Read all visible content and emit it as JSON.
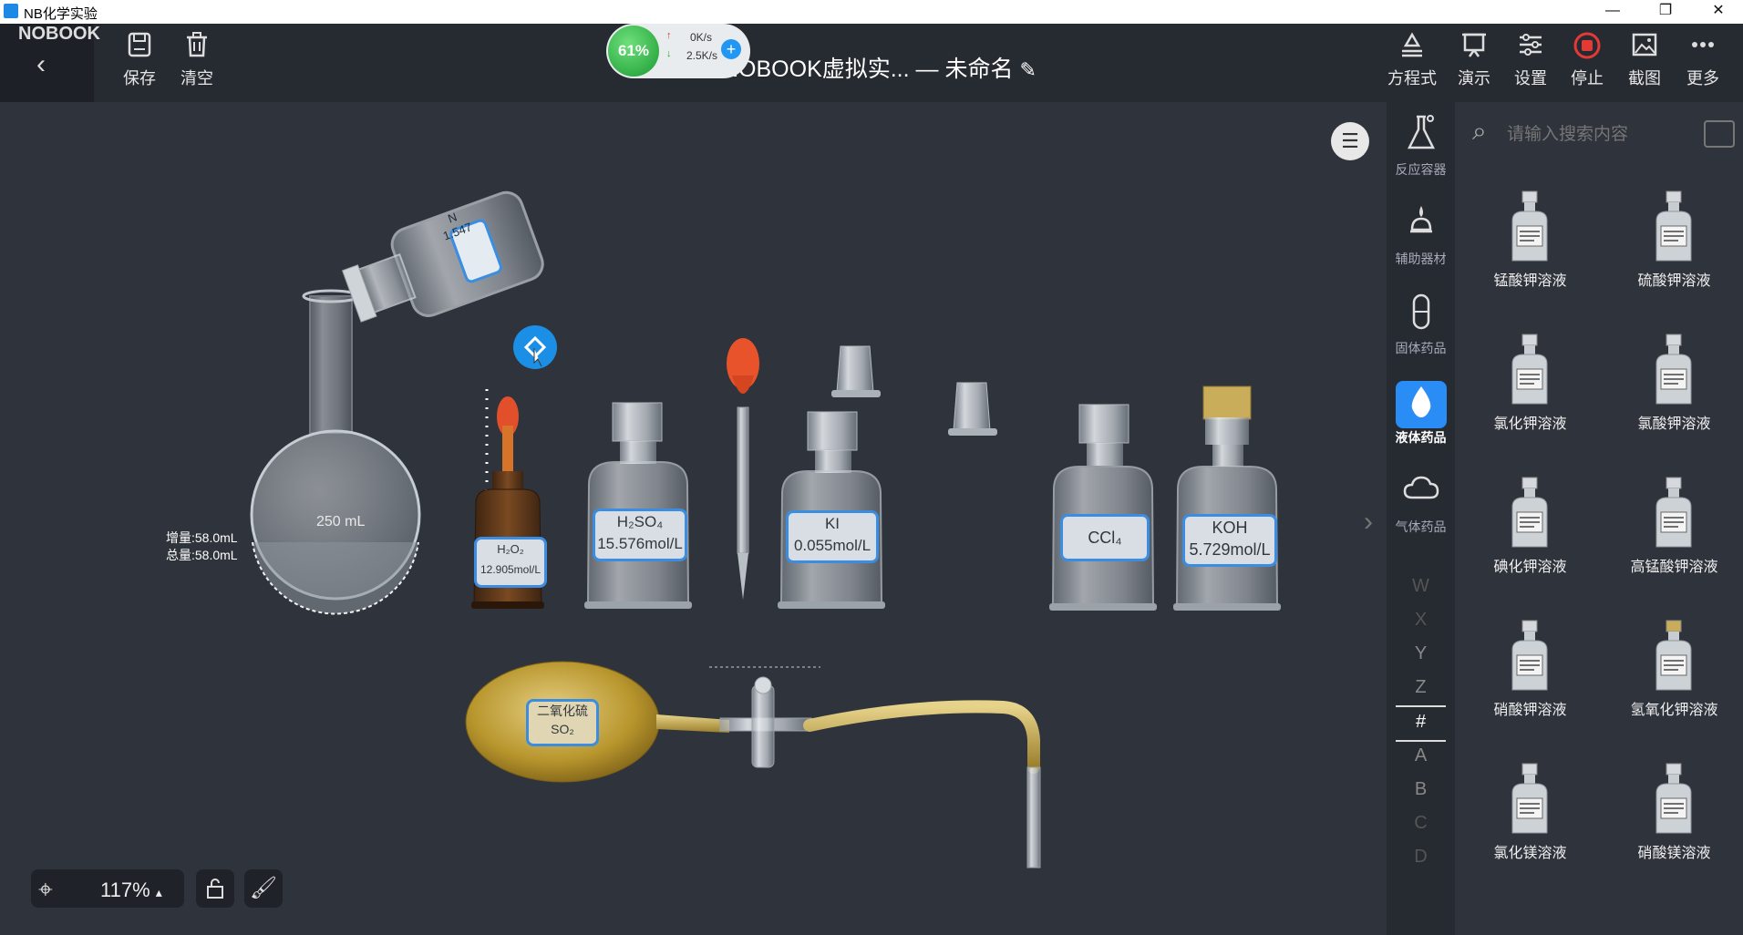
{
  "window": {
    "title": "NB化学实验",
    "minimize": "—",
    "maximize": "❐",
    "close": "✕"
  },
  "logo": "NOBOOK",
  "toolbar": {
    "back": "‹",
    "save_label": "保存",
    "clear_label": "清空",
    "doc_title": "NOBOOK虚拟实... — 未命名",
    "right": [
      {
        "label": "方程式",
        "icon": "equation-icon"
      },
      {
        "label": "演示",
        "icon": "present-icon"
      },
      {
        "label": "设置",
        "icon": "settings-icon"
      },
      {
        "label": "停止",
        "icon": "stop-icon"
      },
      {
        "label": "截图",
        "icon": "screenshot-icon"
      },
      {
        "label": "更多",
        "icon": "more-icon"
      }
    ]
  },
  "gauge": {
    "percent": "61%",
    "up": "0K/s",
    "down": "2.5K/s"
  },
  "sidebar": {
    "categories": [
      {
        "label": "反应容器",
        "icon": "flask-icon"
      },
      {
        "label": "辅助器材",
        "icon": "lamp-icon"
      },
      {
        "label": "固体药品",
        "icon": "capsule-icon"
      },
      {
        "label": "液体药品",
        "icon": "drop-icon"
      },
      {
        "label": "气体药品",
        "icon": "cloud-icon"
      }
    ],
    "letters": [
      "W",
      "X",
      "Y",
      "Z",
      "#",
      "A",
      "B",
      "C",
      "D"
    ]
  },
  "search": {
    "placeholder": "请输入搜索内容"
  },
  "reagents": [
    {
      "name": "锰酸钾溶液"
    },
    {
      "name": "硫酸钾溶液"
    },
    {
      "name": "氯化钾溶液"
    },
    {
      "name": "氯酸钾溶液"
    },
    {
      "name": "碘化钾溶液"
    },
    {
      "name": "高锰酸钾溶液"
    },
    {
      "name": "硝酸钾溶液"
    },
    {
      "name": "氢氧化钾溶液"
    },
    {
      "name": "氯化镁溶液"
    },
    {
      "name": "硝酸镁溶液"
    }
  ],
  "canvas": {
    "flask_volume": "250 mL",
    "increment": "增量:58.0mL",
    "total": "总量:58.0mL",
    "tilted_label": "N",
    "tilted_value": "1.547",
    "h2o2_formula": "H₂O₂",
    "h2o2_conc": "12.905mol/L",
    "h2so4_formula": "H₂SO₄",
    "h2so4_conc": "15.576mol/L",
    "ki_formula": "KI",
    "ki_conc": "0.055mol/L",
    "ccl4_formula": "CCl₄",
    "koh_formula": "KOH",
    "koh_conc": "5.729mol/L",
    "so2_name": "二氧化硫",
    "so2_formula": "SO₂"
  },
  "bottom": {
    "zoom": "117%",
    "zoom_caret": "▴"
  }
}
